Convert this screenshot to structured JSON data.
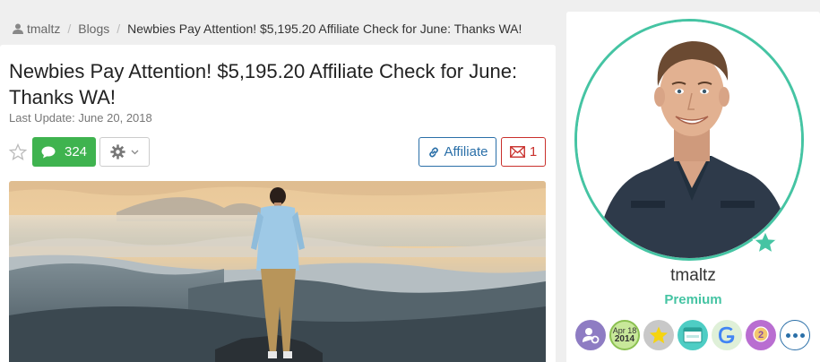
{
  "breadcrumb": {
    "user": "tmaltz",
    "section": "Blogs",
    "current": "Newbies Pay Attention! $5,195.20 Affiliate Check for June: Thanks WA!"
  },
  "post": {
    "title": "Newbies Pay Attention! $5,195.20 Affiliate Check for June: Thanks WA!",
    "last_update": "Last Update: June 20, 2018"
  },
  "actions": {
    "comment_count": "324",
    "affiliate_label": "Affiliate",
    "mail_count": "1"
  },
  "profile": {
    "username": "tmaltz",
    "membership": "Premium",
    "date_badge": {
      "month_day": "Apr 18",
      "year": "2014"
    },
    "achievement_rank": "2"
  },
  "colors": {
    "accent_green": "#3fb34f",
    "premium_teal": "#45c4a3",
    "link_blue": "#2a6fa8",
    "mail_red": "#c9302c"
  },
  "icons": [
    "user-icon",
    "comment-icon",
    "star-icon",
    "gear-icon",
    "chevron-down-icon",
    "link-icon",
    "mail-icon",
    "premium-star-icon",
    "more-icon"
  ]
}
